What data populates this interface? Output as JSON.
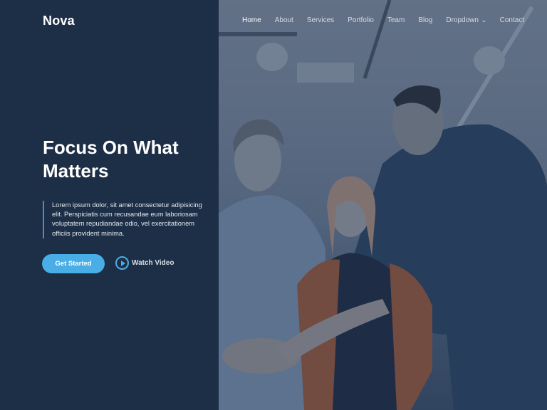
{
  "brand": {
    "logo": "Nova"
  },
  "nav": {
    "items": [
      {
        "label": "Home",
        "active": true
      },
      {
        "label": "About"
      },
      {
        "label": "Services"
      },
      {
        "label": "Portfolio"
      },
      {
        "label": "Team"
      },
      {
        "label": "Blog"
      },
      {
        "label": "Dropdown",
        "icon": "chevron-down-icon"
      },
      {
        "label": "Contact"
      }
    ]
  },
  "hero": {
    "title": "Focus On What Matters",
    "description": "Lorem ipsum dolor, sit amet consectetur adipisicing elit. Perspiciatis cum recusandae eum laboriosam voluptatem repudiandae odio, vel exercitationem officiis provident minima.",
    "cta_primary": "Get Started",
    "cta_secondary": "Watch Video",
    "cta_secondary_icon": "play-circle-icon",
    "image": "team-hands-together-photo"
  },
  "colors": {
    "panel_bg": "#1d2f47",
    "accent": "#4aaee6",
    "quote_border": "#4a8fc4"
  }
}
